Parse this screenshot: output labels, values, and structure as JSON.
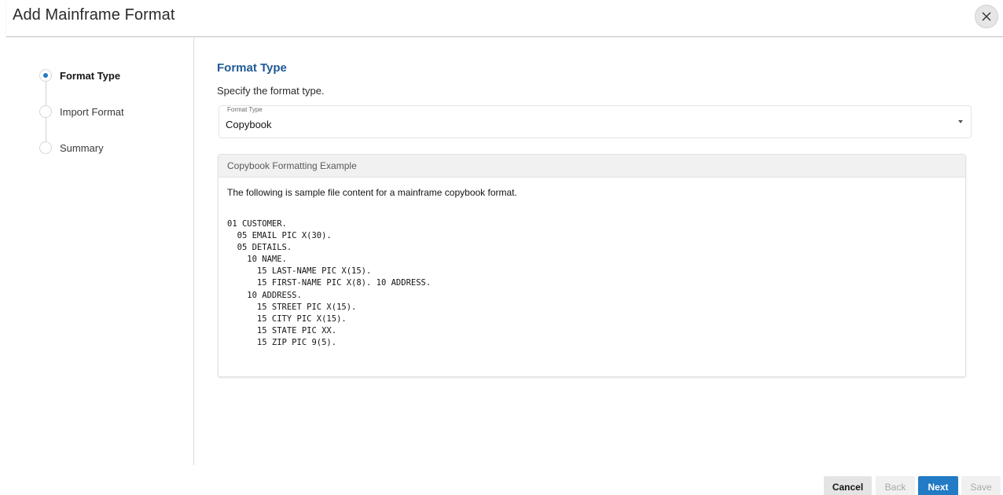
{
  "dialog": {
    "title": "Add Mainframe Format",
    "close_icon": "close-icon"
  },
  "train": {
    "steps": [
      {
        "label": "Format Type",
        "active": true
      },
      {
        "label": "Import Format",
        "active": false
      },
      {
        "label": "Summary",
        "active": false
      }
    ]
  },
  "main": {
    "section_title": "Format Type",
    "description": "Specify the format type.",
    "format_select": {
      "label": "Format Type",
      "value": "Copybook"
    },
    "example": {
      "header": "Copybook Formatting Example",
      "intro": "The following is sample file content for a mainframe copybook format.",
      "code_lines": [
        "01 CUSTOMER.",
        "  05 EMAIL PIC X(30).",
        "  05 DETAILS.",
        "    10 NAME.",
        "      15 LAST-NAME PIC X(15).",
        "      15 FIRST-NAME PIC X(8). 10 ADDRESS.",
        "    10 ADDRESS.",
        "      15 STREET PIC X(15).",
        "      15 CITY PIC X(15).",
        "      15 STATE PIC XX.",
        "      15 ZIP PIC 9(5)."
      ]
    }
  },
  "footer": {
    "cancel": "Cancel",
    "back": "Back",
    "next": "Next",
    "save": "Save"
  },
  "colors": {
    "accent": "#227bc4",
    "section_title": "#1f5a96"
  }
}
